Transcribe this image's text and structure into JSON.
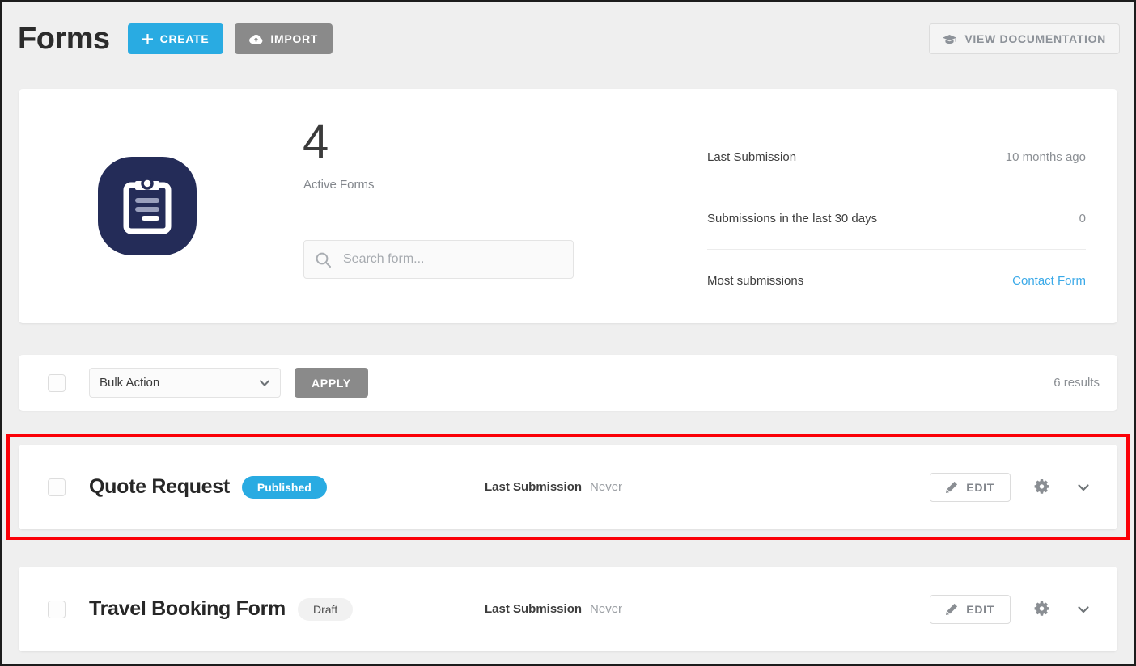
{
  "header": {
    "title": "Forms",
    "create_label": "CREATE",
    "import_label": "IMPORT",
    "doc_label": "VIEW DOCUMENTATION",
    "create_icon": "plus-icon",
    "import_icon": "cloud-upload-icon",
    "doc_icon": "graduation-cap-icon",
    "create_color": "#29abe2",
    "import_color": "#8a8a8a"
  },
  "summary": {
    "app_icon": "clipboard-icon",
    "app_icon_bg": "#242c58",
    "active_count": "4",
    "active_label": "Active Forms",
    "search": {
      "icon": "search-icon",
      "placeholder": "Search form...",
      "value": ""
    },
    "stats": [
      {
        "label": "Last Submission",
        "value": "10 months ago",
        "is_link": false
      },
      {
        "label": "Submissions in the last 30 days",
        "value": "0",
        "is_link": false
      },
      {
        "label": "Most submissions",
        "value": "Contact Form",
        "is_link": true
      }
    ]
  },
  "bulk_bar": {
    "select_all_checkbox": "unchecked",
    "select_value": "Bulk Action",
    "select_icon": "chevron-down-icon",
    "apply_label": "APPLY",
    "results_text": "6 results"
  },
  "forms": [
    {
      "checkbox": "unchecked",
      "name": "Quote Request",
      "status": "Published",
      "status_kind": "published",
      "last_submission_label": "Last Submission",
      "last_submission_value": "Never",
      "edit_label": "EDIT",
      "edit_icon": "pencil-icon",
      "settings_icon": "gear-icon",
      "expand_icon": "chevron-down-icon",
      "highlighted": true
    },
    {
      "checkbox": "unchecked",
      "name": "Travel Booking Form",
      "status": "Draft",
      "status_kind": "draft",
      "last_submission_label": "Last Submission",
      "last_submission_value": "Never",
      "edit_label": "EDIT",
      "edit_icon": "pencil-icon",
      "settings_icon": "gear-icon",
      "expand_icon": "chevron-down-icon",
      "highlighted": false
    }
  ],
  "highlight": {
    "color": "#fb0007",
    "target": "Quote Request"
  }
}
